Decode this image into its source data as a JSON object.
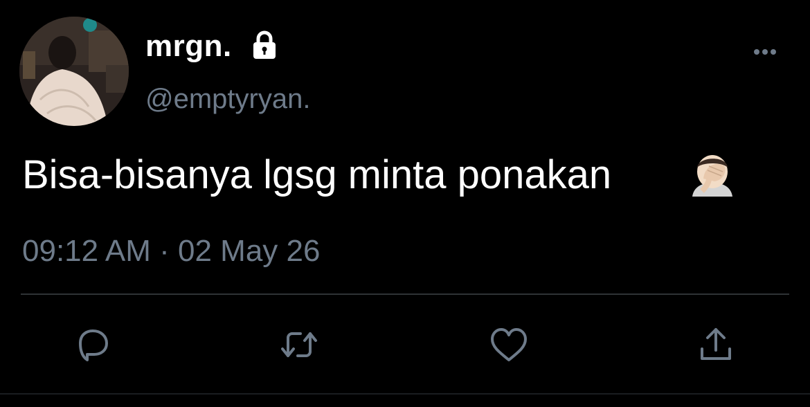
{
  "user": {
    "display_name": "mrgn.",
    "handle": "@emptyryan.",
    "protected_icon": "lock-icon",
    "avatar": "profile-photo"
  },
  "tweet": {
    "text": "Bisa-bisanya lgsg minta ponakan",
    "emoji": "facepalm-icon",
    "timestamp": "09:12 AM · 02 May 26"
  },
  "actions": [
    {
      "icon": "reply-icon"
    },
    {
      "icon": "retweet-icon"
    },
    {
      "icon": "like-icon"
    },
    {
      "icon": "share-icon"
    }
  ],
  "menu": {
    "icon": "more-options-icon"
  },
  "colors": {
    "background": "#000000",
    "primary_text": "#ffffff",
    "secondary_text": "#6e7b8a",
    "divider": "#2f3336"
  }
}
